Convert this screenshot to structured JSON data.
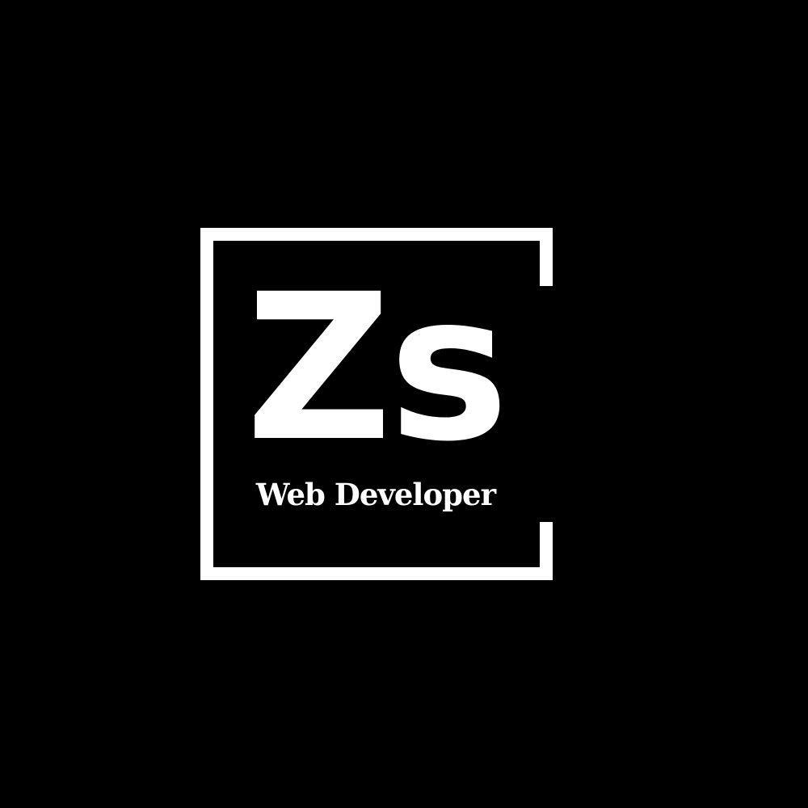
{
  "logo": {
    "monogram": "Zs",
    "tagline": "Web Developer"
  },
  "colors": {
    "background": "#000000",
    "foreground": "#ffffff"
  }
}
